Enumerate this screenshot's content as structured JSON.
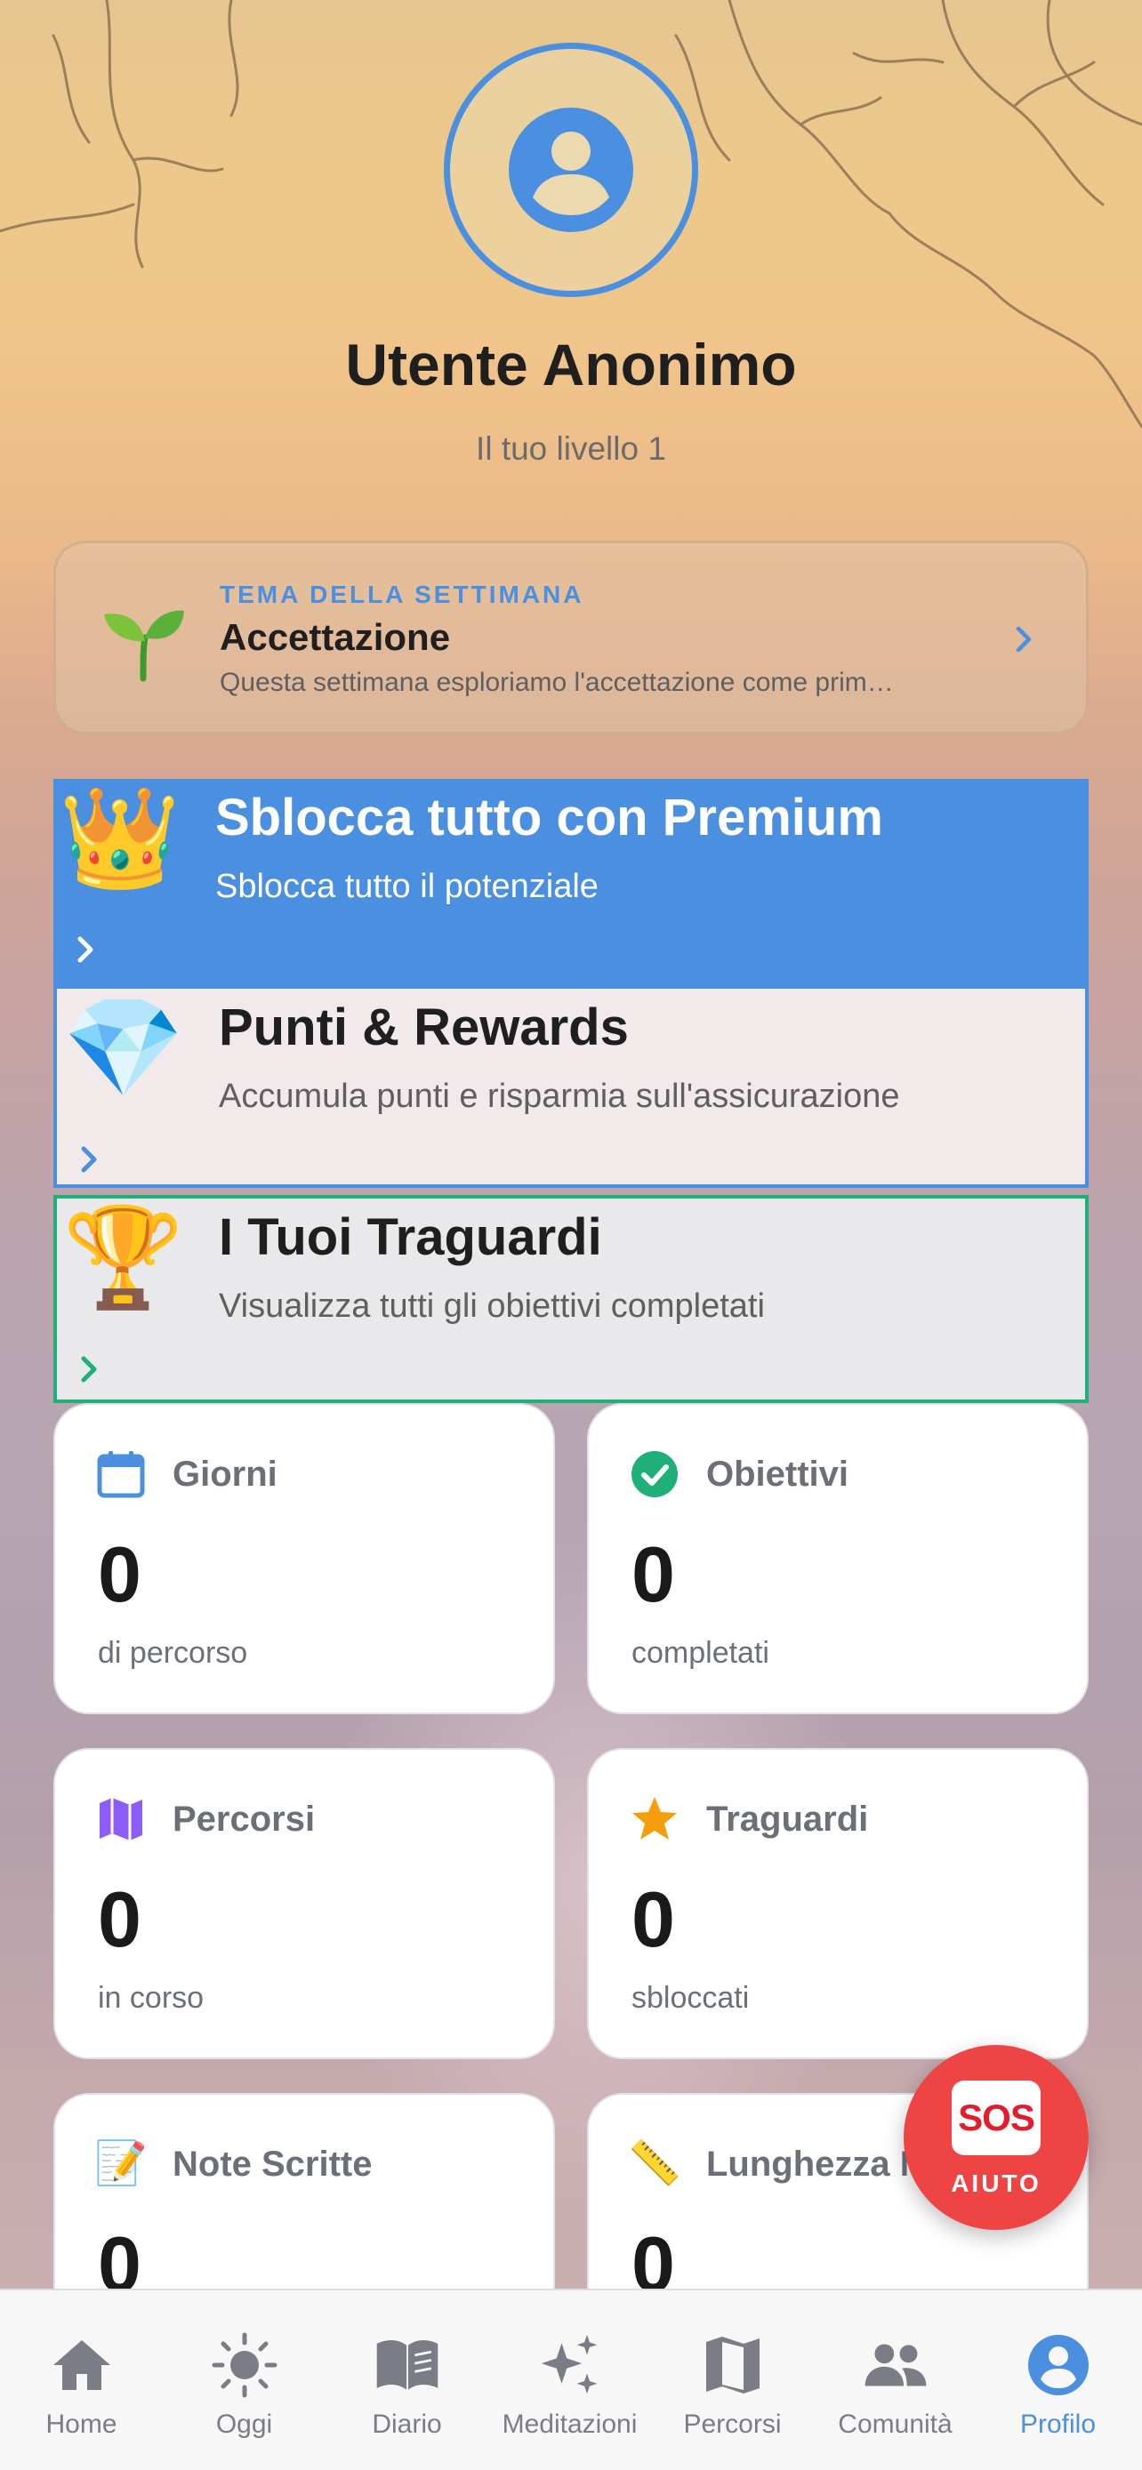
{
  "profile": {
    "name": "Utente Anonimo",
    "level": "Il tuo livello 1"
  },
  "theme_card": {
    "eyebrow": "TEMA DELLA SETTIMANA",
    "title": "Accettazione",
    "description": "Questa settimana esploriamo l'accettazione come prim…",
    "icon": "seedling-icon"
  },
  "promos": {
    "premium": {
      "emoji": "👑",
      "title": "Sblocca tutto con Premium",
      "subtitle": "Sblocca tutto il potenziale",
      "color": "#4a8fe0"
    },
    "rewards": {
      "emoji": "💎",
      "title": "Punti & Rewards",
      "subtitle": "Accumula punti e risparmia sull'assicurazione",
      "color": "#4a8fe0"
    },
    "goals": {
      "emoji": "🏆",
      "title": "I Tuoi Traguardi",
      "subtitle": "Visualizza tutti gli obiettivi completati",
      "color": "#1fb07a"
    }
  },
  "stats": [
    {
      "icon": "calendar-icon",
      "label": "Giorni",
      "value": "0",
      "sub": "di percorso"
    },
    {
      "icon": "check-circle-icon",
      "label": "Obiettivi",
      "value": "0",
      "sub": "completati"
    },
    {
      "icon": "map-icon",
      "label": "Percorsi",
      "value": "0",
      "sub": "in corso"
    },
    {
      "icon": "star-icon",
      "label": "Traguardi",
      "value": "0",
      "sub": "sbloccati"
    },
    {
      "icon": "memo-icon",
      "label": "Note Scritte",
      "value": "0"
    },
    {
      "icon": "ruler-icon",
      "label": "Lunghezza M",
      "value": "0"
    }
  ],
  "sos": {
    "badge": "SOS",
    "label": "AIUTO",
    "color": "#ef4444"
  },
  "tabs": [
    {
      "label": "Home",
      "icon": "home-icon"
    },
    {
      "label": "Oggi",
      "icon": "sun-icon"
    },
    {
      "label": "Diario",
      "icon": "book-icon"
    },
    {
      "label": "Meditazioni",
      "icon": "sparkles-icon"
    },
    {
      "label": "Percorsi",
      "icon": "map-icon"
    },
    {
      "label": "Comunità",
      "icon": "people-icon"
    },
    {
      "label": "Profilo",
      "icon": "profile-icon",
      "active": true
    }
  ],
  "colors": {
    "accent": "#4a8fe0",
    "success": "#1fb07a",
    "danger": "#ef4444"
  }
}
